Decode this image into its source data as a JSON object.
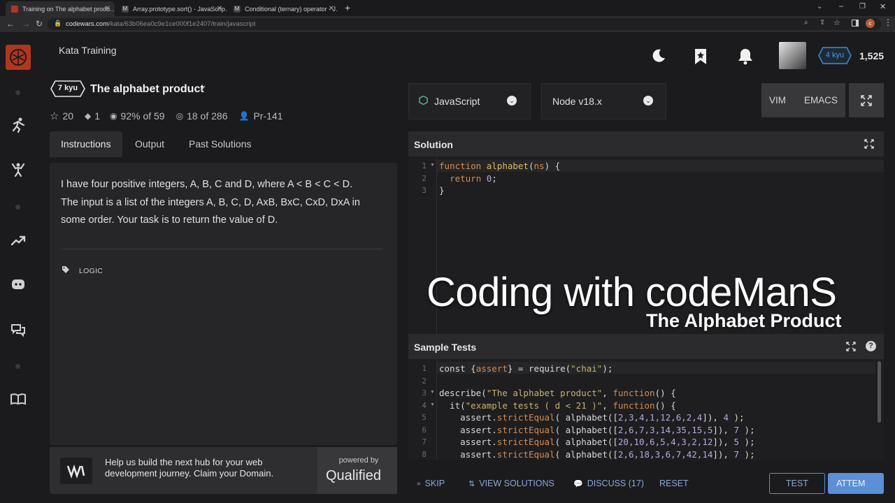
{
  "browser": {
    "tabs": [
      {
        "label": "Training on The alphabet produ…"
      },
      {
        "label": "Array.prototype.sort() - JavaScrip…"
      },
      {
        "label": "Conditional (ternary) operator - J…"
      }
    ],
    "url_host": "codewars.com",
    "url_path": "/kata/63b06ea0c9e1ce000f1e2407/train/javascript"
  },
  "header": {
    "section_title": "Kata Training",
    "rank_badge": "4 kyu",
    "honor": "1,525"
  },
  "kata": {
    "kyu": "7 kyu",
    "title": "The alphabet product",
    "check": "✓",
    "stars": "20",
    "collections": "1",
    "satisfaction": "92% of 59",
    "completed": "18 of 286",
    "author": "Pr-141"
  },
  "tabs": {
    "instructions": "Instructions",
    "output": "Output",
    "past_solutions": "Past Solutions"
  },
  "instructions": {
    "line1": "I have four positive integers, A, B, C and D, where A < B < C < D.",
    "line2": "The input is a list of the integers A, B, C, D, AxB, BxC, CxD, DxA in",
    "line3": "some order. Your task is to return the value of D.",
    "tag": "LOGIC"
  },
  "promo": {
    "text_line1": "Help us build the next hub for your web",
    "text_line2": "development journey. Claim your Domain.",
    "powered_by": "powered by",
    "brand": "Qualified"
  },
  "editor": {
    "language": "JavaScript",
    "runtime": "Node v18.x",
    "vim": "VIM",
    "emacs": "EMACS",
    "solution_label": "Solution",
    "sample_tests_label": "Sample Tests",
    "solution_lines": [
      "1",
      "2",
      "3"
    ],
    "test_lines": [
      "1",
      "2",
      "3",
      "4",
      "5",
      "6",
      "7",
      "8"
    ]
  },
  "overlay": {
    "title": "Coding with codeManS",
    "subtitle": "The Alphabet Product"
  },
  "bottom_bar": {
    "skip": "SKIP",
    "view_solutions": "VIEW SOLUTIONS",
    "discuss": "DISCUSS (17)",
    "reset": "RESET",
    "test": "TEST",
    "attempt": "ATTEM"
  },
  "colors": {
    "accent_red": "#b1361e",
    "rank_blue": "#3c7ebb",
    "attempt_blue": "#5b8fd6"
  }
}
